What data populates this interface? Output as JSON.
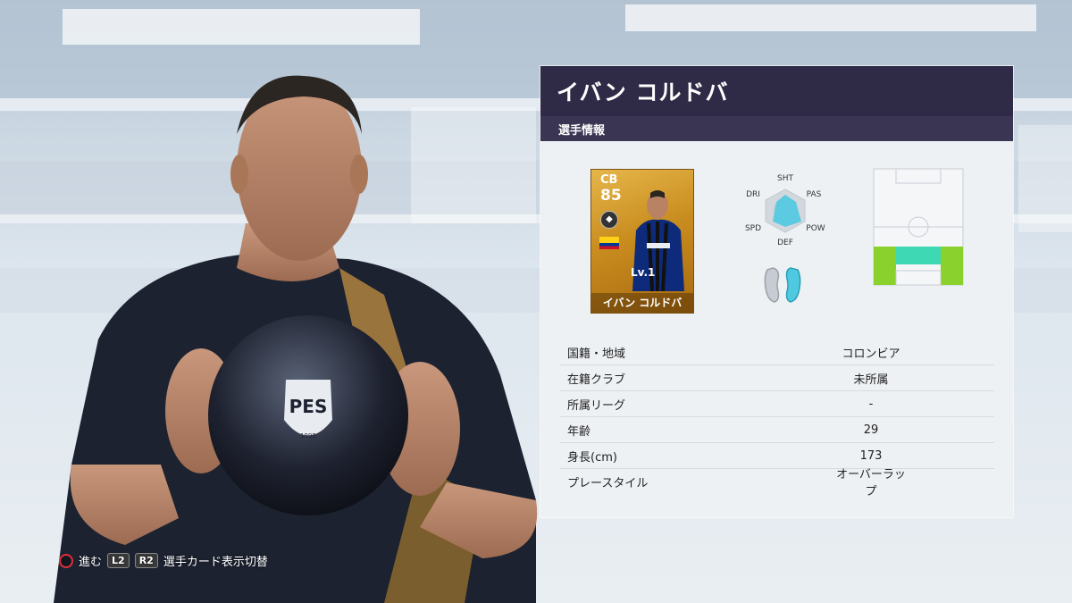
{
  "player": {
    "name": "イバン コルドバ",
    "section": "選手情報",
    "card": {
      "position": "CB",
      "rating": "85",
      "level": "Lv.1",
      "name": "イバン コルドバ"
    }
  },
  "radar_labels": {
    "sht": "SHT",
    "pas": "PAS",
    "pow": "POW",
    "def": "DEF",
    "spd": "SPD",
    "dri": "DRI"
  },
  "info_rows": [
    {
      "label": "国籍・地域",
      "value": "コロンビア"
    },
    {
      "label": "在籍クラブ",
      "value": "未所属"
    },
    {
      "label": "所属リーグ",
      "value": "-"
    },
    {
      "label": "年齢",
      "value": "29"
    },
    {
      "label": "身長(cm)",
      "value": "173"
    },
    {
      "label": "プレースタイル",
      "value": "オーバーラップ"
    }
  ],
  "footer": {
    "advance_label": "進む",
    "l2_label": "L2",
    "r2_label": "R2",
    "toggle_label": "選手カード表示切替"
  },
  "colors": {
    "header_bg": "#2f2a45",
    "subheader_bg": "#3a3553",
    "card_gold": "#c98d1f",
    "radar_fill": "#4fc9e0",
    "pitch_active": "#8ad12e",
    "pitch_highlight": "#3fd8b5",
    "foot_preferred": "#4fc9e0"
  }
}
